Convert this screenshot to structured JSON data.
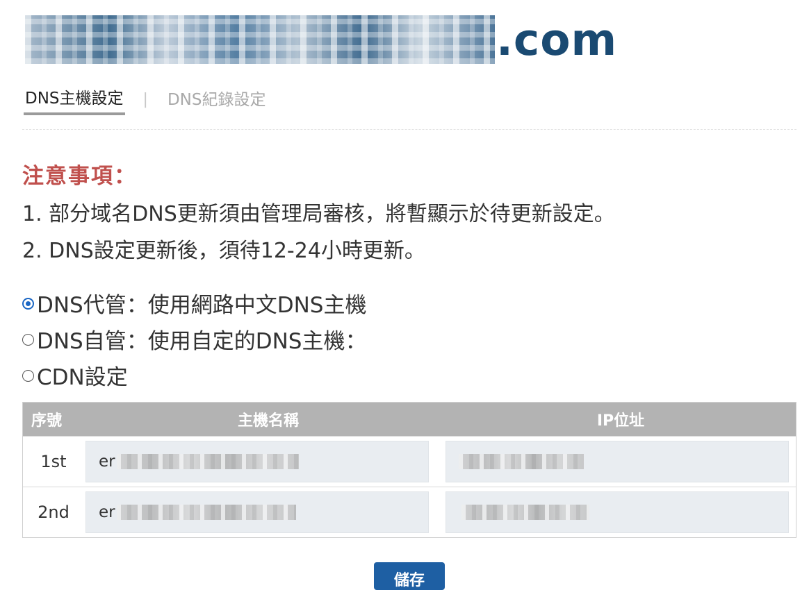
{
  "header": {
    "domain_tld": ".com"
  },
  "tabs": [
    {
      "label": "DNS主機設定"
    },
    {
      "label": "DNS紀錄設定"
    }
  ],
  "tab_separator": "|",
  "notice": {
    "title": "注意事項：",
    "line1": "1. 部分域名DNS更新須由管理局審核，將暫顯示於待更新設定。",
    "line2": "2. DNS設定更新後，須待12-24小時更新。"
  },
  "options": [
    {
      "label": "DNS代管：使用網路中文DNS主機",
      "selected": true
    },
    {
      "label": "DNS自管：使用自定的DNS主機：",
      "selected": false
    },
    {
      "label": "CDN設定",
      "selected": false
    }
  ],
  "table": {
    "headers": {
      "seq": "序號",
      "host": "主機名稱",
      "ip": "IP位址"
    },
    "rows": [
      {
        "seq": "1st",
        "host_prefix": "er"
      },
      {
        "seq": "2nd",
        "host_prefix": "er"
      }
    ]
  },
  "save_button": {
    "label": "儲存"
  },
  "colors": {
    "accent": "#1e5fa3",
    "notice_title": "#c0504d",
    "table_header": "#b3b3b3",
    "input_bg": "#e9edf1",
    "radio_checked": "#1a66c4"
  }
}
